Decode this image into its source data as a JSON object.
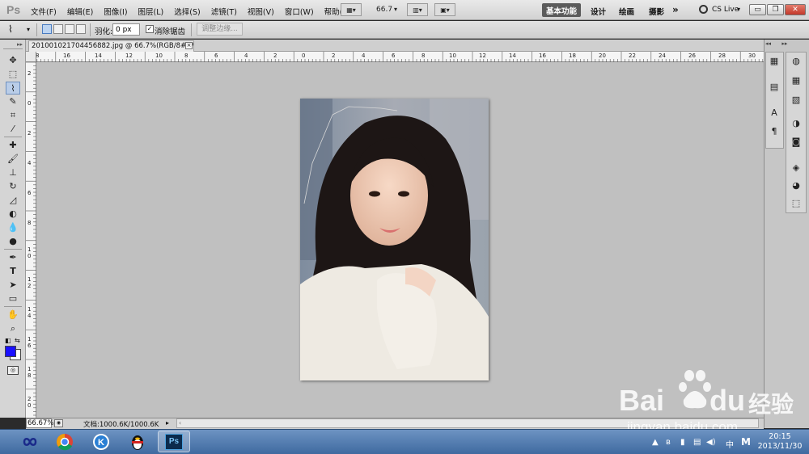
{
  "app": {
    "logo": "Ps"
  },
  "menu": {
    "items": [
      "文件(F)",
      "编辑(E)",
      "图像(I)",
      "图层(L)",
      "选择(S)",
      "滤镜(T)",
      "视图(V)",
      "窗口(W)",
      "帮助(H)"
    ],
    "zoom_value": "66.7"
  },
  "workspaces": {
    "basic": "基本功能",
    "design": "设计",
    "paint": "绘画",
    "photo": "摄影",
    "more": "»",
    "cs_live": "CS Live"
  },
  "options": {
    "feather_label": "羽化:",
    "feather_value": "0 px",
    "antialias_label": "消除锯齿",
    "antialias_checked": true,
    "refine_edge": "调整边缘..."
  },
  "document": {
    "tab_title": "201001021704456882.jpg @ 66.7%(RGB/8#) *",
    "close": "×"
  },
  "rulers": {
    "top": [
      "8",
      "16",
      "14",
      "12",
      "10",
      "8",
      "6",
      "4",
      "2",
      "0",
      "2",
      "4",
      "6",
      "8",
      "10",
      "12",
      "14",
      "16",
      "18",
      "20",
      "22",
      "24",
      "26",
      "28",
      "30"
    ],
    "left": [
      "2",
      "0",
      "2",
      "4",
      "6",
      "8",
      "1 0",
      "1 2",
      "1 4",
      "1 6",
      "1 8",
      "2 0"
    ]
  },
  "status": {
    "zoom": "66.67%",
    "doc_info": "文档:1000.6K/1000.6K",
    "arrow": "▸"
  },
  "taskbar": {
    "apps": [
      "infinity-app",
      "chrome",
      "k-player",
      "qq",
      "photoshop"
    ],
    "ps_label": "Ps",
    "tray": [
      "▲",
      "ʙ",
      "▮",
      "▤",
      "◀)",
      "中",
      "M"
    ],
    "time": "20:15",
    "date": "2013/11/30"
  },
  "watermark": {
    "brand": "Bai",
    "brand2": "du",
    "cn": "经验",
    "url": "jingyan.baidu.com"
  },
  "colors": {
    "foreground": "#1a10ff",
    "background": "#ffffff",
    "taskbar": "#4a76ad",
    "canvas": "#c0c0c0"
  }
}
